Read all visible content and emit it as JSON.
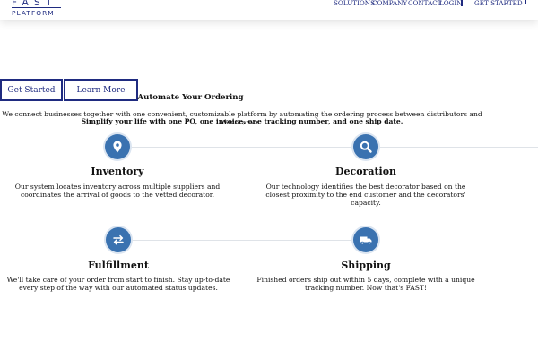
{
  "header": {
    "logo": {
      "line1": "FAST",
      "line2": "PLATFORM"
    },
    "nav": [
      "SOLUTIONS",
      "COMPANY",
      "CONTACT",
      "LOGIN"
    ],
    "cta": "GET STARTED"
  },
  "hero": {
    "buttons": {
      "get_started": "Get Started",
      "learn_more": "Learn More"
    },
    "title": "Automate Your Ordering",
    "intro": "We connect businesses together with one convenient, customizable platform by automating the ordering process between distributors and decorators.",
    "tagline": "Simplify your life with one PO, one invoice, one tracking number, and one ship date."
  },
  "features": [
    {
      "icon": "location-pin-icon",
      "title": "Inventory",
      "desc": "Our system locates inventory across multiple suppliers and coordinates the arrival of goods to the vetted decorator."
    },
    {
      "icon": "search-icon",
      "title": "Decoration",
      "desc": "Our technology identifies the best decorator based on the closest proximity to the end customer and the decorators' capacity."
    },
    {
      "icon": "swap-arrows-icon",
      "title": "Fulfillment",
      "desc": "We'll take care of your order from start to finish. Stay up-to-date every step of the way with our automated status updates."
    },
    {
      "icon": "delivery-truck-icon",
      "title": "Shipping",
      "desc": "Finished orders ship out within 5 days, complete with a unique tracking number. Now that's FAST!"
    }
  ],
  "colors": {
    "brand": "#1f2b80",
    "icon_bg": "#3a72b0",
    "connector": "#dfe3e8"
  }
}
